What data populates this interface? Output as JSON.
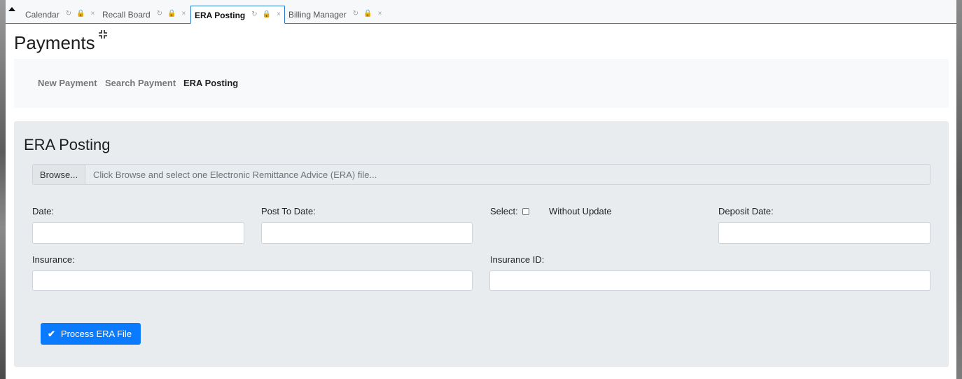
{
  "tabs": [
    {
      "label": "Calendar",
      "active": false
    },
    {
      "label": "Recall Board",
      "active": false
    },
    {
      "label": "ERA Posting",
      "active": true
    },
    {
      "label": "Billing Manager",
      "active": false
    }
  ],
  "tab_icons": {
    "refresh": "↻",
    "lock": "🔒",
    "close": "×"
  },
  "page": {
    "title": "Payments"
  },
  "subnav": {
    "new_payment": "New Payment",
    "search_payment": "Search Payment",
    "era_posting": "ERA Posting"
  },
  "panel": {
    "title": "ERA Posting",
    "browse_label": "Browse...",
    "file_placeholder": "Click Browse and select one Electronic Remittance Advice (ERA) file...",
    "date_label": "Date:",
    "post_to_date_label": "Post To Date:",
    "select_label": "Select:",
    "without_update_label": "Without Update",
    "deposit_date_label": "Deposit Date:",
    "insurance_label": "Insurance:",
    "insurance_id_label": "Insurance ID:",
    "process_button": "Process ERA File"
  },
  "colors": {
    "accent": "#2e80c8",
    "primary_button": "#0a7bff",
    "panel_bg": "#e9ecef"
  }
}
